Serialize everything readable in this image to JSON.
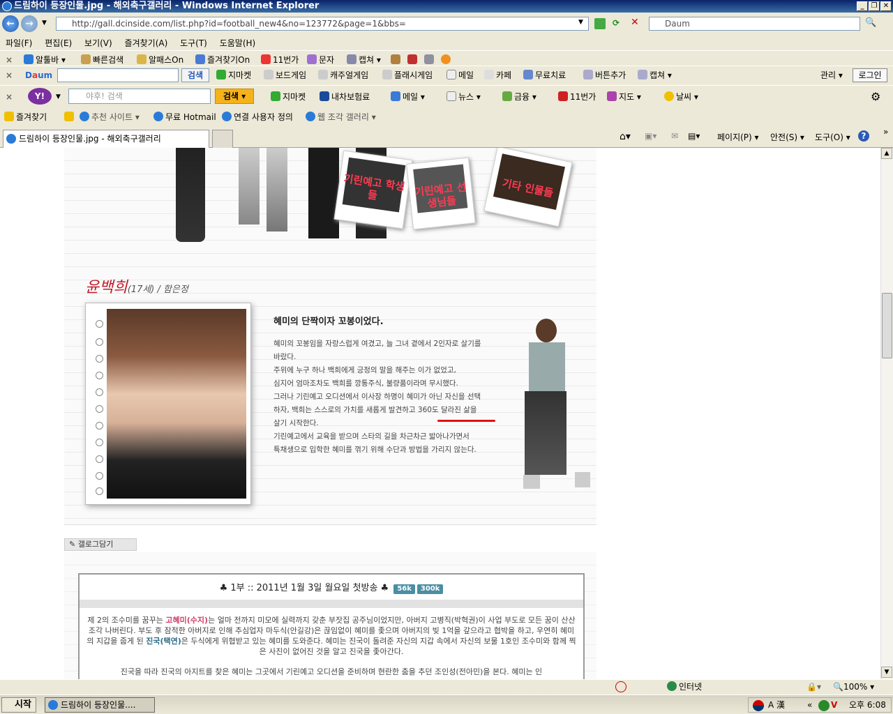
{
  "window": {
    "title": "드림하이 등장인물.jpg - 해외축구갤러리 - Windows Internet Explorer"
  },
  "address": {
    "url": "http://gall.dcinside.com/list.php?id=football_new4&no=123772&page=1&bbs=",
    "search_placeholder": "Daum"
  },
  "menu": [
    "파일(F)",
    "편집(E)",
    "보기(V)",
    "즐겨찾기(A)",
    "도구(T)",
    "도움말(H)"
  ],
  "toolbar1": [
    "알툴바",
    "빠른검색",
    "알패스On",
    "즐겨찾기On",
    "11번가",
    "문자",
    "캡쳐"
  ],
  "toolbar2": {
    "search_btn": "검색",
    "items": [
      "지마켓",
      "보드게임",
      "캐주얼게임",
      "플래시게임",
      "메일",
      "카페",
      "무료치료",
      "버튼추가",
      "캡쳐"
    ],
    "manage": "관리",
    "login": "로그인"
  },
  "toolbar3": {
    "search_placeholder": "야후! 검색",
    "search_btn": "검색",
    "items": [
      "지마켓",
      "내차보험료",
      "메일",
      "뉴스",
      "금융",
      "11번가",
      "지도",
      "날씨"
    ]
  },
  "favorites": {
    "label": "즐겨찾기",
    "items": [
      "추천 사이트",
      "무료 Hotmail",
      "연결 사용자 정의",
      "웹 조각 갤러리"
    ]
  },
  "tab": {
    "title": "드림하이 등장인물.jpg - 해외축구갤러리"
  },
  "cmdbar": [
    "페이지(P)",
    "안전(S)",
    "도구(O)"
  ],
  "page": {
    "photos": [
      {
        "label": "기린예고 학생들"
      },
      {
        "label": "기린예고 선생님들"
      },
      {
        "label": "기타 인물들"
      }
    ],
    "char_name": "윤백희",
    "char_sub": "(17세) / 함은정",
    "bio_heading": "혜미의 단짝이자 꼬봉이었다.",
    "bio": [
      "혜미의 꼬봉임을 자랑스럽게 여겼고, 늘 그녀 곁에서 2인자로 살기를",
      "바랐다.",
      "주위에 누구 하나 백희에게 긍정의 말을 해주는 이가 없었고,",
      "심지어 엄마조차도 백희를 깡통주식, 불량품이라며 무시했다.",
      "그러나 기린예고 오디션에서 이사장 하명이 혜미가 아닌 자신을 선택",
      "하자, 백희는 스스로의 가치를 새롭게 발견하고 360도 달라진 삶을",
      "살기 시작한다.",
      "기린예고에서 교육을 받으며 스타의 길을 차근차근 밟아나가면서",
      "특채생으로 입학한 혜미를 꺾기 위해 수단과 방법을 가리지 않는다."
    ],
    "blog_btn": "갤로그담기",
    "episode": {
      "title": "♣ 1부 :: 2011년 1월 3일 월요일 첫방송 ♣",
      "badge1": "56k",
      "badge2": "300k",
      "p1_a": "제 2의 조수미를 꿈꾸는 ",
      "p1_hl": "고혜미(수지)",
      "p1_b": "는 얼마 전까지 미모에 실력까지 갖춘 부잣집 공주님이었지만, 아버지 고병직(박혁권)이 사업 부도로 모든 꿈이 산산조각 나버린다. 부도 후 잠적한 아버지로 인해 추심업자 마두식(안길강)은 끊임없이 혜미를 좇으며 아버지의 빚 1억을 갚으라고 협박을 하고, 우연히 혜미의 지갑을 줍게 된 ",
      "p1_hl2": "진국(택연)",
      "p1_c": "은 두식에게 위협받고 있는 혜미를 도와준다. 혜미는 진국이 돌려준 자신의 지갑 속에서 자신의 보물 1호인 조수미와 함께 찍은 사진이 없어진 것을 알고 진국을 좇아간다.",
      "p2": "진국을 따라 진국의 아지트를 찾은 혜미는 그곳에서 기린예고 오디션을 준비하며 현란한 춤을 추던 조인성(전아민)을 본다. 혜미는 인"
    }
  },
  "status": {
    "zone": "인터넷",
    "zoom": "100%"
  },
  "taskbar": {
    "start": "시작",
    "task": "드림하이 등장인물....",
    "clock": "오후 6:08",
    "ime": "A 漢"
  }
}
